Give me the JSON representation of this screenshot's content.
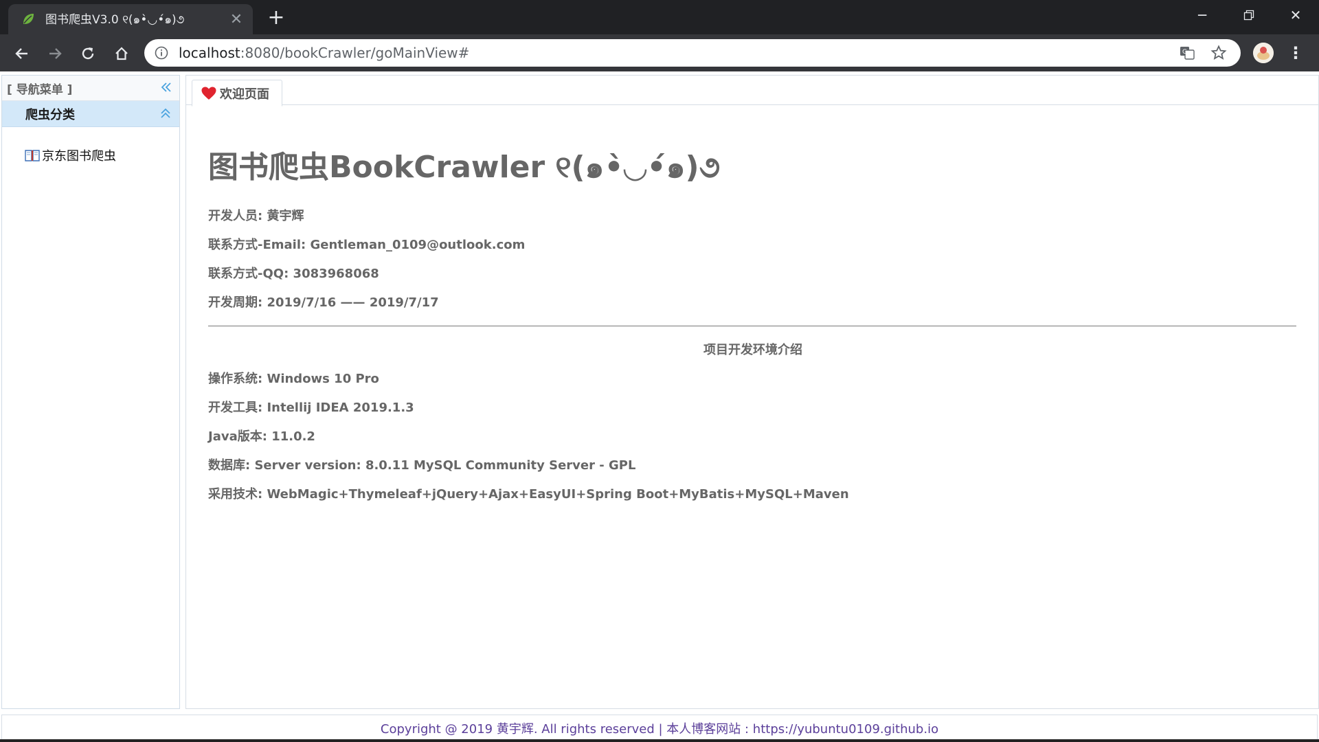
{
  "browser": {
    "tab_title": "图书爬虫V3.0 ୧(๑•̀◡•́๑)૭",
    "url_host": "localhost",
    "url_rest": ":8080/bookCrawler/goMainView#"
  },
  "sidebar": {
    "title": "[ 导航菜单 ]",
    "accordion_title": "爬虫分类",
    "items": [
      {
        "label": "京东图书爬虫"
      }
    ]
  },
  "center": {
    "tab_label": "欢迎页面",
    "heading": "图书爬虫BookCrawler ୧(๑•̀◡•́๑)૭",
    "info": [
      "开发人员: 黄宇辉",
      "联系方式-Email: Gentleman_0109@outlook.com",
      "联系方式-QQ: 3083968068",
      "开发周期: 2019/7/16 —— 2019/7/17"
    ],
    "env_title": "项目开发环境介绍",
    "env": [
      "操作系统: Windows 10 Pro",
      "开发工具: Intellij IDEA 2019.1.3",
      "Java版本: 11.0.2",
      "数据库: Server version: 8.0.11 MySQL Community Server - GPL",
      "采用技术: WebMagic+Thymeleaf+jQuery+Ajax+EasyUI+Spring Boot+MyBatis+MySQL+Maven"
    ]
  },
  "footer": {
    "text": "Copyright @ 2019 黄宇辉. All rights reserved | 本人博客网站 : https://yubuntu0109.github.io"
  },
  "colors": {
    "chrome_dark": "#202124",
    "toolbar": "#35363a",
    "accordion_selected": "#d3e8f9",
    "easyui_blue": "#4aa3df",
    "footer_text": "#5b3f9a"
  }
}
